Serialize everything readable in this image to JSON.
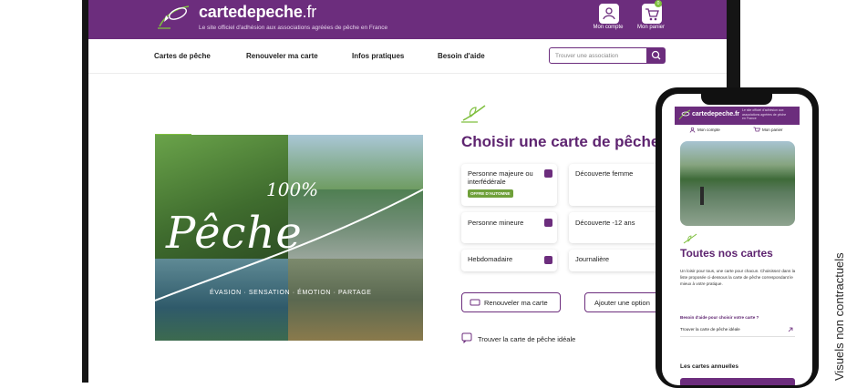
{
  "site": {
    "brand": "cartedepeche",
    "brand_tld": ".fr",
    "tagline": "Le site officiel d'adhésion aux associations agréées de pêche en France",
    "account_label": "Mon compte",
    "cart_label": "Mon panier",
    "cart_count": "0"
  },
  "nav": {
    "items": [
      "Cartes de pêche",
      "Renouveler ma carte",
      "Infos pratiques",
      "Besoin d'aide"
    ],
    "search_placeholder": "Trouver une association"
  },
  "hero": {
    "big_number": "100%",
    "word": "Pêche",
    "subline": "ÉVASION · SENSATION · ÉMOTION · PARTAGE"
  },
  "main": {
    "title": "Choisir une carte de pêche",
    "cards": [
      {
        "label": "Personne majeure ou interfédérale",
        "badge": "OFFRE D'AUTOMNE"
      },
      {
        "label": "Découverte femme"
      },
      {
        "label": "Personne mineure"
      },
      {
        "label": "Découverte -12 ans"
      },
      {
        "label": "Hebdomadaire"
      },
      {
        "label": "Journalière"
      }
    ],
    "renew_button": "Renouveler ma carte",
    "add_button": "Ajouter une option",
    "find_link": "Trouver la carte de pêche idéale"
  },
  "phone": {
    "brand": "cartedepeche.fr",
    "tagline": "Le site officiel d'adhésion aux associations agréées de pêche en France",
    "account_label": "Mon compte",
    "cart_label": "Mon panier",
    "title": "Toutes nos cartes",
    "paragraph": "Un loisir pour tous, une carte pour chacun. Choisissez dans la liste proposée ci-dessous la carte de pêche correspondant le mieux à votre pratique.",
    "help_title": "Besoin d'aide pour choisir votre carte ?",
    "find_link": "Trouver la carte de pêche idéale",
    "annual_title": "Les cartes annuelles"
  },
  "side_note": "Visuels non contractuels",
  "colors": {
    "brand_purple": "#6c2d7d",
    "accent_green": "#7fbf3f"
  }
}
